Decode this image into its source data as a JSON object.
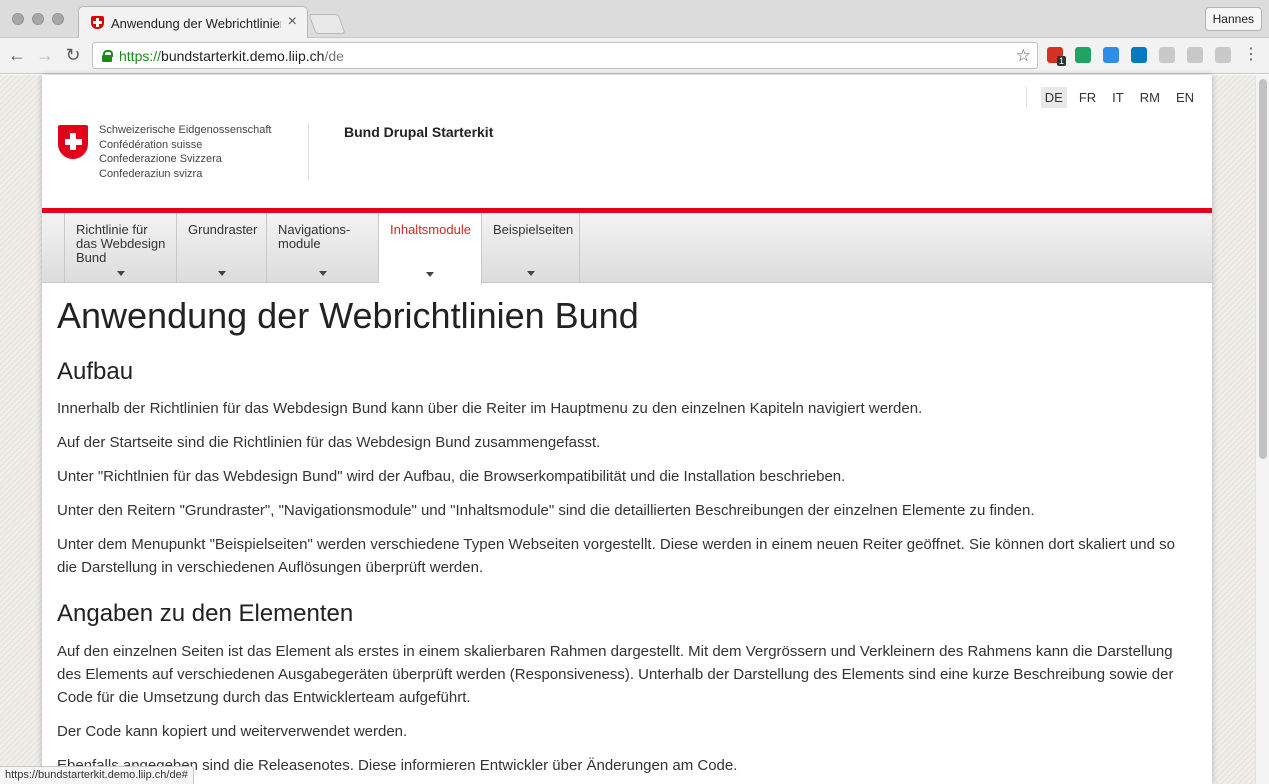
{
  "browser": {
    "tab_title": "Anwendung der Webrichtlinien Bund",
    "tab_close": "×",
    "profile_name": "Hannes",
    "url_scheme": "https://",
    "url_host": "bundstarterkit.demo.liip.ch",
    "url_path": "/de",
    "status_url": "https://bundstarterkit.demo.liip.ch/de#",
    "extensions": [
      {
        "name": "gmail-counter-icon",
        "color": "#d93025",
        "badge": "1"
      },
      {
        "name": "google-drive-icon",
        "color": "#1fa463"
      },
      {
        "name": "at-sign-icon",
        "color": "#2e8de6"
      },
      {
        "name": "trello-icon",
        "color": "#0079bf"
      },
      {
        "name": "grey-extension-icon",
        "color": "#c8c8c8"
      },
      {
        "name": "grey-extension-icon-2",
        "color": "#c8c8c8"
      },
      {
        "name": "grey-extension-icon-3",
        "color": "#c8c8c8"
      }
    ]
  },
  "header": {
    "languages": [
      "DE",
      "FR",
      "IT",
      "RM",
      "EN"
    ],
    "active_language": "DE",
    "confederation_lines": [
      "Schweizerische Eidgenossenschaft",
      "Confédération suisse",
      "Confederazione Svizzera",
      "Confederaziun svizra"
    ],
    "site_name": "Bund Drupal Starterkit",
    "brand_color": "#e2001a"
  },
  "nav": {
    "items": [
      {
        "label": "Richtlinie für das Webdesign Bund"
      },
      {
        "label": "Grundraster"
      },
      {
        "label": "Navigations-module"
      },
      {
        "label": "Inhaltsmodule",
        "active": true
      },
      {
        "label": "Beispielseiten"
      }
    ]
  },
  "content": {
    "title": "Anwendung der Webrichtlinien Bund",
    "section1_heading": "Aufbau",
    "section1_paragraphs": [
      "Innerhalb der Richtlinien für das Webdesign Bund kann über die Reiter im Hauptmenu zu den einzelnen Kapiteln navigiert werden.",
      "Auf der Startseite sind die Richtlinien für das Webdesign Bund zusammengefasst.",
      "Unter \"Richtlnien für das Webdesign Bund\" wird der Aufbau, die Browserkompatibilität und die Installation beschrieben.",
      "Unter den Reitern \"Grundraster\", \"Navigationsmodule\" und \"Inhaltsmodule\" sind die detaillierten Beschreibungen der einzelnen Elemente zu finden.",
      "Unter dem Menupunkt \"Beispielseiten\" werden verschiedene Typen Webseiten vorgestellt. Diese werden in einem neuen Reiter geöffnet. Sie können dort skaliert und so die Darstellung in verschiedenen Auflösungen überprüft werden."
    ],
    "section2_heading": "Angaben zu den Elementen",
    "section2_paragraphs": [
      "Auf den einzelnen Seiten ist das Element als erstes in einem skalierbaren Rahmen dargestellt. Mit dem Vergrössern und Verkleinern des Rahmens kann die Darstellung des Elements auf verschiedenen Ausgabegeräten überprüft werden (Responsiveness). Unterhalb der Darstellung des Elements sind eine kurze Beschreibung sowie der Code für die Umsetzung durch das Entwicklerteam aufgeführt.",
      "Der Code kann kopiert und weiterverwendet werden.",
      "Ebenfalls angegeben sind die Releasenotes. Diese informieren Entwickler über Änderungen am Code."
    ]
  }
}
